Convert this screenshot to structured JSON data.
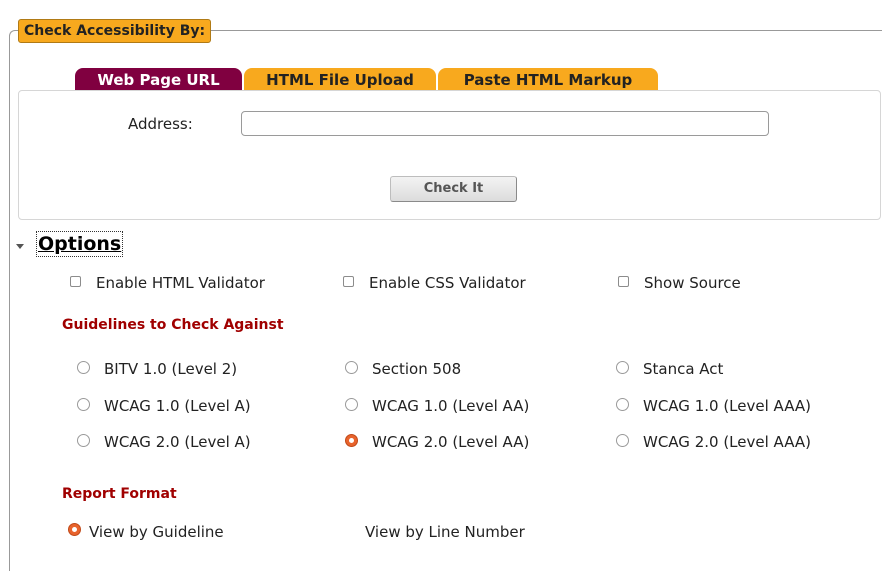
{
  "legend": "Check Accessibility By:",
  "tabs": [
    {
      "label": "Web Page URL",
      "active": true
    },
    {
      "label": "HTML File Upload",
      "active": false
    },
    {
      "label": "Paste HTML Markup",
      "active": false
    }
  ],
  "url_form": {
    "address_label": "Address:",
    "address_value": "",
    "check_button": "Check It"
  },
  "options": {
    "title": "Options",
    "expanded": true,
    "checkboxes": [
      {
        "label": "Enable HTML Validator",
        "checked": false
      },
      {
        "label": "Enable CSS Validator",
        "checked": false
      },
      {
        "label": "Show Source",
        "checked": false
      }
    ]
  },
  "guidelines": {
    "heading": "Guidelines to Check Against",
    "items": [
      {
        "label": "BITV 1.0 (Level 2)",
        "checked": false
      },
      {
        "label": "Section 508",
        "checked": false
      },
      {
        "label": "Stanca Act",
        "checked": false
      },
      {
        "label": "WCAG 1.0 (Level A)",
        "checked": false
      },
      {
        "label": "WCAG 1.0 (Level AA)",
        "checked": false
      },
      {
        "label": "WCAG 1.0 (Level AAA)",
        "checked": false
      },
      {
        "label": "WCAG 2.0 (Level A)",
        "checked": false
      },
      {
        "label": "WCAG 2.0 (Level AA)",
        "checked": true
      },
      {
        "label": "WCAG 2.0 (Level AAA)",
        "checked": false
      }
    ]
  },
  "report_format": {
    "heading": "Report Format",
    "items": [
      {
        "label": "View by Guideline",
        "checked": true
      },
      {
        "label": "View by Line Number",
        "checked": false
      }
    ]
  },
  "colors": {
    "tab_active": "#800040",
    "tab_inactive": "#f8a91e",
    "section_heading": "#a00000",
    "radio_checked": "#e8632c"
  }
}
